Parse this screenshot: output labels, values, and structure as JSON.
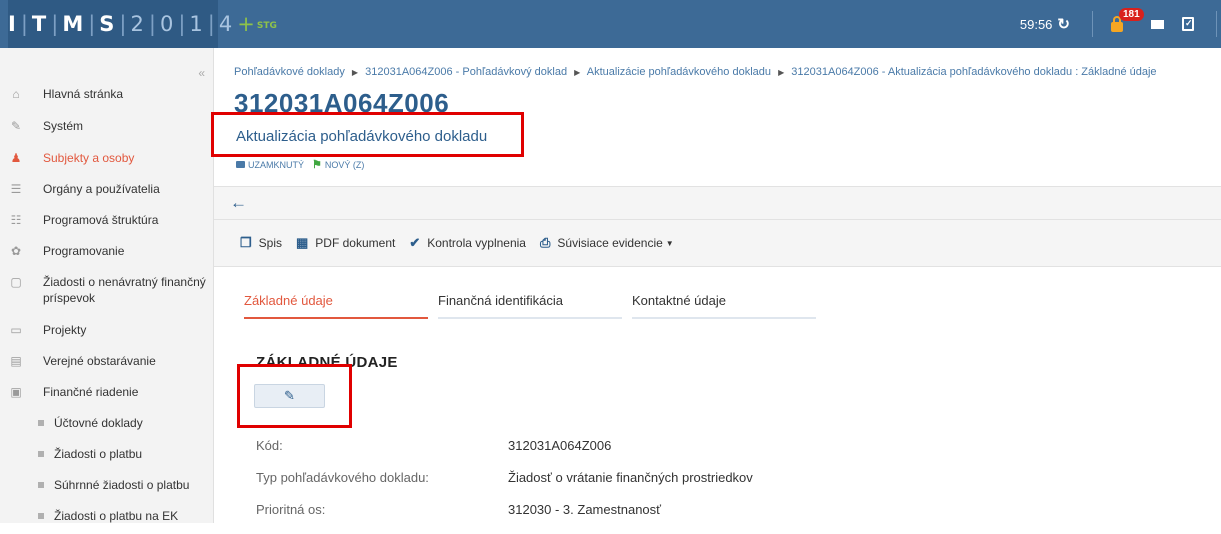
{
  "logo": {
    "letters": [
      "I",
      "T",
      "M",
      "S"
    ],
    "sep": "|",
    "digits": [
      "2",
      "0",
      "1",
      "4"
    ],
    "plus": "+",
    "env": "STG"
  },
  "header": {
    "timer": "59:56",
    "refresh_icon": "refresh-icon",
    "notifications_count": "181"
  },
  "sidebar": {
    "items": [
      {
        "label": "Hlavná stránka",
        "icon": "home-icon"
      },
      {
        "label": "Systém",
        "icon": "wrench-icon"
      },
      {
        "label": "Subjekty a osoby",
        "icon": "people-icon",
        "active": true
      },
      {
        "label": "Orgány a používatelia",
        "icon": "users-icon"
      },
      {
        "label": "Programová štruktúra",
        "icon": "sitemap-icon"
      },
      {
        "label": "Programovanie",
        "icon": "cog-icon"
      },
      {
        "label": "Žiadosti o nenávratný finančný príspevok",
        "icon": "document-icon"
      },
      {
        "label": "Projekty",
        "icon": "folder-icon"
      },
      {
        "label": "Verejné obstarávanie",
        "icon": "briefcase-icon"
      },
      {
        "label": "Finančné riadenie",
        "icon": "wallet-icon"
      }
    ],
    "subitems": [
      "Účtovné doklady",
      "Žiadosti o platbu",
      "Súhrnné žiadosti o platbu",
      "Žiadosti o platbu na EK"
    ]
  },
  "breadcrumb": [
    "Pohľadávkové doklady",
    "312031A064Z006 - Pohľadávkový doklad",
    "Aktualizácie pohľadávkového dokladu",
    "312031A064Z006 - Aktualizácia pohľadávkového dokladu : Základné údaje"
  ],
  "page": {
    "id": "312031A064Z006",
    "subtitle": "Aktualizácia pohľadávkového dokladu",
    "status_locked": "UZAMKNUTÝ",
    "status_new": "NOVÝ (Z)"
  },
  "toolbar": {
    "spis": "Spis",
    "pdf": "PDF dokument",
    "kontrola": "Kontrola vyplnenia",
    "suvisiace": "Súvisiace evidencie"
  },
  "tabs": [
    "Základné údaje",
    "Finančná identifikácia",
    "Kontaktné údaje"
  ],
  "section": {
    "title": "ZÁKLADNÉ ÚDAJE"
  },
  "fields": [
    {
      "label": "Kód:",
      "value": "312031A064Z006"
    },
    {
      "label": "Typ pohľadávkového dokladu:",
      "value": "Žiadosť o vrátanie finančných prostriedkov"
    },
    {
      "label": "Prioritná os:",
      "value": "312030 - 3. Zamestnanosť"
    }
  ],
  "colors": {
    "topbar": "#3d6a96",
    "accent": "#e2583e",
    "link": "#2d5e8c",
    "highlight": "#e00000"
  }
}
